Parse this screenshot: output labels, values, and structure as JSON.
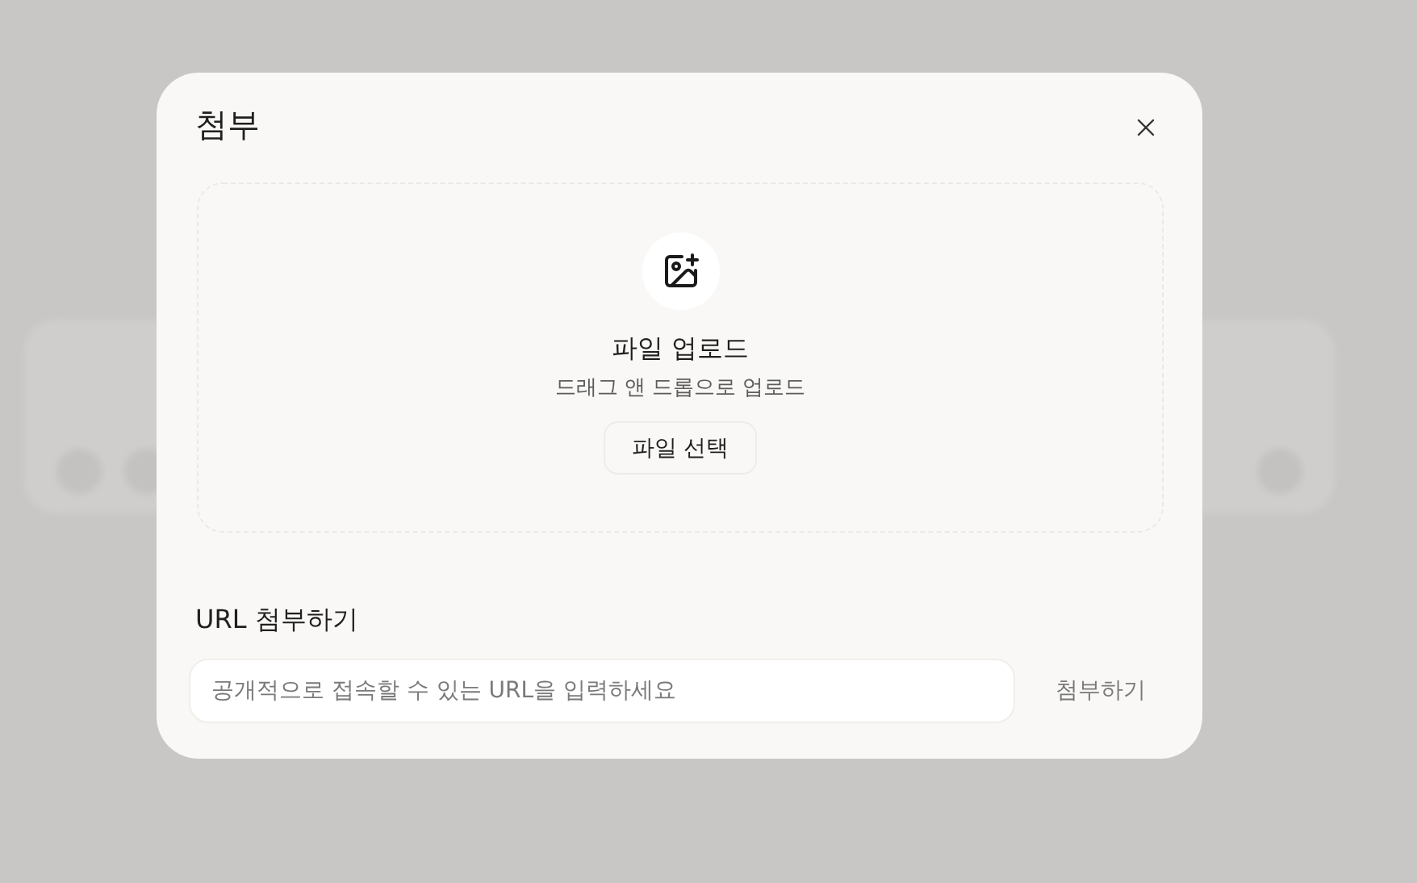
{
  "dialog": {
    "title": "첨부",
    "upload": {
      "title": "파일 업로드",
      "subtitle": "드래그 앤 드롭으로 업로드",
      "button": "파일 선택"
    },
    "url": {
      "label": "URL 첨부하기",
      "placeholder": "공개적으로 접속할 수 있는 URL을 입력하세요",
      "button": "첨부하기"
    }
  }
}
